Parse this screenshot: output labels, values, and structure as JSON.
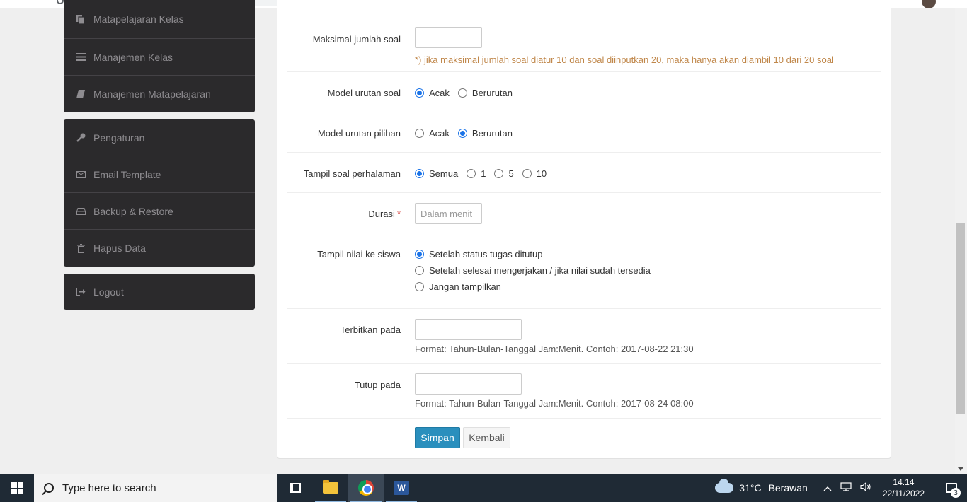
{
  "sidebar": {
    "group1": [
      {
        "label": "Matapelajaran Kelas",
        "icon": "copy-icon"
      },
      {
        "label": "Manajemen Kelas",
        "icon": "list-icon"
      },
      {
        "label": "Manajemen Matapelajaran",
        "icon": "book-icon"
      }
    ],
    "group2": [
      {
        "label": "Pengaturan",
        "icon": "wrench-icon"
      },
      {
        "label": "Email Template",
        "icon": "envelope-icon"
      },
      {
        "label": "Backup & Restore",
        "icon": "hdd-icon"
      },
      {
        "label": "Hapus Data",
        "icon": "trash-icon"
      }
    ],
    "logout": {
      "label": "Logout",
      "icon": "sign-out-icon"
    }
  },
  "form": {
    "max_questions": {
      "label": "Maksimal jumlah soal",
      "value": "",
      "hint": "*) jika maksimal jumlah soal diatur 10 dan soal diinputkan 20, maka hanya akan diambil 10 dari 20 soal"
    },
    "question_order": {
      "label": "Model urutan soal",
      "options": [
        "Acak",
        "Berurutan"
      ],
      "selected": "Acak"
    },
    "choice_order": {
      "label": "Model urutan pilihan",
      "options": [
        "Acak",
        "Berurutan"
      ],
      "selected": "Berurutan"
    },
    "per_page": {
      "label": "Tampil soal perhalaman",
      "options": [
        "Semua",
        "1",
        "5",
        "10"
      ],
      "selected": "Semua"
    },
    "duration": {
      "label": "Durasi",
      "required_mark": "*",
      "placeholder": "Dalam menit"
    },
    "show_score": {
      "label": "Tampil nilai ke siswa",
      "options": [
        "Setelah status tugas ditutup",
        "Setelah selesai mengerjakan / jika nilai sudah tersedia",
        "Jangan tampilkan"
      ],
      "selected": "Setelah status tugas ditutup"
    },
    "publish_at": {
      "label": "Terbitkan pada",
      "value": "",
      "hint": "Format: Tahun-Bulan-Tanggal Jam:Menit. Contoh: 2017-08-22 21:30"
    },
    "close_at": {
      "label": "Tutup pada",
      "value": "",
      "hint": "Format: Tahun-Bulan-Tanggal Jam:Menit. Contoh: 2017-08-24 08:00"
    },
    "buttons": {
      "save": "Simpan",
      "back": "Kembali"
    }
  },
  "colors": {
    "sidebar_bg": "#2b2a2c",
    "primary_button": "#2a8fbd",
    "warning_text": "#c0874a",
    "radio_checked": "#1a73e8",
    "taskbar": "#1f2a35"
  },
  "taskbar": {
    "search_placeholder": "Type here to search",
    "apps": [
      "task-view-icon",
      "file-explorer-icon",
      "chrome-icon",
      "word-icon"
    ],
    "weather_temp": "31°C",
    "weather_condition": "Berawan",
    "time": "14.14",
    "date": "22/11/2022",
    "notification_count": "3"
  }
}
